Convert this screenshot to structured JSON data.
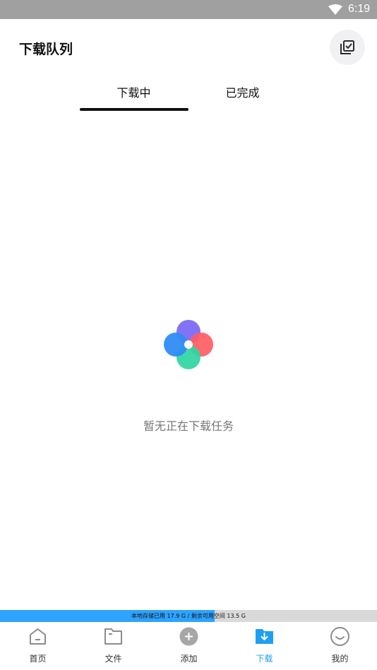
{
  "status_bar": {
    "time": "6:19"
  },
  "header": {
    "title": "下载队列"
  },
  "tabs": [
    {
      "label": "下载中",
      "active": true
    },
    {
      "label": "已完成",
      "active": false
    }
  ],
  "empty_state": {
    "message": "暂无正在下载任务"
  },
  "storage": {
    "text": "本地存储已用 17.9 G / 剩余可用空间 13.5 G",
    "used_fraction": 0.57
  },
  "bottom_nav": [
    {
      "label": "首页",
      "icon": "home-icon"
    },
    {
      "label": "文件",
      "icon": "folder-icon"
    },
    {
      "label": "添加",
      "icon": "add-icon"
    },
    {
      "label": "下载",
      "icon": "download-folder-icon",
      "active": true
    },
    {
      "label": "我的",
      "icon": "smile-icon"
    }
  ],
  "colors": {
    "accent": "#1f9ff0",
    "storage_fill": "#2ea3ff"
  }
}
